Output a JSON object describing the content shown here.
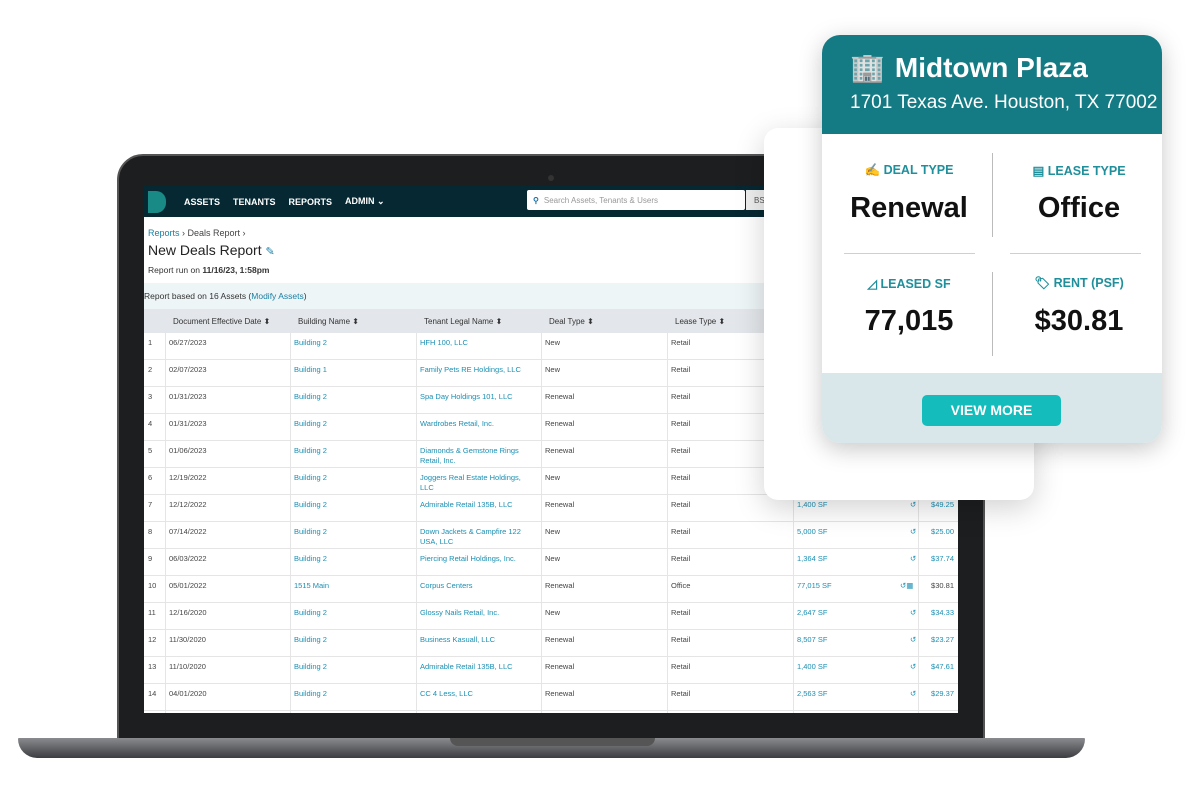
{
  "nav": {
    "items": [
      "ASSETS",
      "TENANTS",
      "REPORTS",
      "ADMIN ⌄"
    ],
    "search_placeholder": "Search Assets, Tenants & Users",
    "user": "BS"
  },
  "breadcrumb": [
    "Reports",
    "Deals Report"
  ],
  "report": {
    "title": "New Deals Report",
    "run_prefix": "Report run on ",
    "run_time": "11/16/23, 1:58pm",
    "based_prefix": "Report based on 16 Assets (",
    "modify_link": "Modify Assets",
    "based_suffix": ")"
  },
  "columns": [
    "Document Effective Date ⬍",
    "Building Name ⬍",
    "Tenant Legal Name ⬍",
    "Deal Type ⬍",
    "Lease Type ⬍"
  ],
  "rows": [
    [
      "1",
      "06/27/2023",
      "Building 2",
      "HFH 100, LLC",
      "New",
      "Retail",
      "",
      ""
    ],
    [
      "2",
      "02/07/2023",
      "Building 1",
      "Family Pets RE Holdings, LLC",
      "New",
      "Retail",
      "",
      ""
    ],
    [
      "3",
      "01/31/2023",
      "Building 2",
      "Spa Day Holdings 101, LLC",
      "Renewal",
      "Retail",
      "",
      ""
    ],
    [
      "4",
      "01/31/2023",
      "Building 2",
      "Wardrobes Retail, Inc.",
      "Renewal",
      "Retail",
      "",
      ""
    ],
    [
      "5",
      "01/06/2023",
      "Building 2",
      "Diamonds & Gemstone Rings Retail, Inc.",
      "Renewal",
      "Retail",
      "",
      ""
    ],
    [
      "6",
      "12/19/2022",
      "Building 2",
      "Joggers Real Estate Holdings, LLC",
      "New",
      "Retail",
      "",
      ""
    ],
    [
      "7",
      "12/12/2022",
      "Building 2",
      "Admirable Retail 135B, LLC",
      "Renewal",
      "Retail",
      "1,400 SF",
      "$49.25"
    ],
    [
      "8",
      "07/14/2022",
      "Building 2",
      "Down Jackets & Campfire 122 USA, LLC",
      "New",
      "Retail",
      "5,000 SF",
      "$25.00"
    ],
    [
      "9",
      "06/03/2022",
      "Building 2",
      "Piercing Retail Holdings, Inc.",
      "New",
      "Retail",
      "1,364 SF",
      "$37.74"
    ],
    [
      "10",
      "05/01/2022",
      "1515 Main",
      "Corpus Centers",
      "Renewal",
      "Office",
      "77,015 SF",
      "$30.81"
    ],
    [
      "11",
      "12/16/2020",
      "Building 2",
      "Glossy Nails Retail, Inc.",
      "New",
      "Retail",
      "2,647 SF",
      "$34.33"
    ],
    [
      "12",
      "11/30/2020",
      "Building 2",
      "Business Kasuall, LLC",
      "Renewal",
      "Retail",
      "8,507 SF",
      "$23.27"
    ],
    [
      "13",
      "11/10/2020",
      "Building 2",
      "Admirable Retail 135B, LLC",
      "Renewal",
      "Retail",
      "1,400 SF",
      "$47.61"
    ],
    [
      "14",
      "04/01/2020",
      "Building 2",
      "CC 4 Less, LLC",
      "Renewal",
      "Retail",
      "2,563 SF",
      "$29.37"
    ]
  ],
  "card": {
    "name": "Midtown Plaza",
    "address": "1701 Texas Ave. Houston, TX 77002",
    "deal_type_label": "DEAL TYPE",
    "deal_type": "Renewal",
    "lease_type_label": "LEASE TYPE",
    "lease_type": "Office",
    "leased_sf_label": "LEASED SF",
    "leased_sf": "77,015",
    "rent_label": "RENT (PSF)",
    "rent": "$30.81",
    "button": "VIEW MORE"
  },
  "colors": {
    "teal_header": "#147a83",
    "button": "#14bcbc",
    "link": "#1a8fb3",
    "nav": "#062832"
  }
}
